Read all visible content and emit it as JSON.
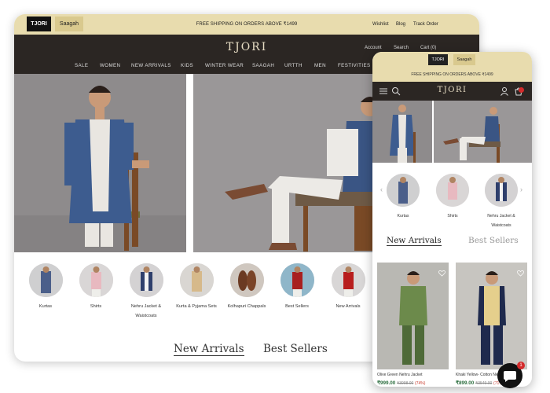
{
  "desktop": {
    "brand_tabs": [
      "TJORI",
      "Saagah"
    ],
    "shipping_text": "FREE SHIPPING ON ORDERS ABOVE ₹1499",
    "top_links": [
      "Wishlist",
      "Blog",
      "Track Order"
    ],
    "logo": "TJORI",
    "header_links": [
      "Account",
      "Search",
      "Cart (0)"
    ],
    "nav": [
      "SALE",
      "WOMEN",
      "NEW ARRIVALS",
      "KIDS",
      "WINTER WEAR",
      "SAAGAH",
      "URTTH",
      "MEN",
      "FESTIVITIES"
    ],
    "categories": [
      {
        "line1": "Kurtas",
        "line2": ""
      },
      {
        "line1": "Shirts",
        "line2": ""
      },
      {
        "line1": "Nehru Jacket &",
        "line2": "Waistcoats"
      },
      {
        "line1": "Kurta & Pyjama Sets",
        "line2": ""
      },
      {
        "line1": "Kolhapuri Chappals",
        "line2": ""
      },
      {
        "line1": "Best Sellers",
        "line2": ""
      },
      {
        "line1": "New Arrivals",
        "line2": ""
      }
    ],
    "tabs": [
      "New Arrivals",
      "Best Sellers"
    ]
  },
  "mobile": {
    "brand_tabs": [
      "TJORI",
      "Saagah"
    ],
    "shipping_text": "FREE SHIPPING ON ORDERS ABOVE ₹1499",
    "logo": "TJORI",
    "categories": [
      {
        "line1": "Kurtas",
        "line2": ""
      },
      {
        "line1": "Shirts",
        "line2": ""
      },
      {
        "line1": "Nehru Jacket &",
        "line2": "Waistcoats"
      }
    ],
    "tabs": [
      "New Arrivals",
      "Best Sellers"
    ],
    "products": [
      {
        "name": "Olive Green Nehru Jacket",
        "price": "₹999.00",
        "old_price": "₹3998.00",
        "discount": "(74%)"
      },
      {
        "name": "Khaki Yellow- Cotton Nehru",
        "price": "₹899.00",
        "old_price": "₹3549.00",
        "discount": "(71%)"
      }
    ]
  },
  "chat": {
    "badge": "1"
  },
  "colors": {
    "top_bar": "#e8dcae",
    "header": "#2b2623",
    "price": "#2c6e3f",
    "discount": "#c8392b"
  }
}
